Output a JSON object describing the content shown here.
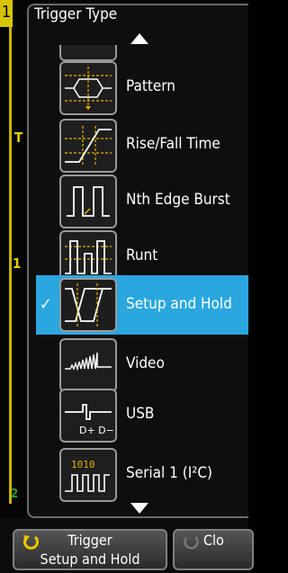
{
  "channel_marker": "1",
  "menu": {
    "title": "Trigger Type",
    "items": [
      {
        "label": "Pattern",
        "icon": "pattern-trigger-icon",
        "selected": false
      },
      {
        "label": "Rise/Fall Time",
        "icon": "rise-fall-time-icon",
        "selected": false
      },
      {
        "label": "Nth Edge Burst",
        "icon": "nth-edge-burst-icon",
        "selected": false
      },
      {
        "label": "Runt",
        "icon": "runt-icon",
        "selected": false
      },
      {
        "label": "Setup and Hold",
        "icon": "setup-and-hold-icon",
        "selected": true
      },
      {
        "label": "Video",
        "icon": "video-icon",
        "selected": false
      },
      {
        "label": "USB",
        "icon": "usb-icon",
        "selected": false
      },
      {
        "label": "Serial 1 (I²C)",
        "icon": "serial-i2c-icon",
        "selected": false
      }
    ]
  },
  "scope_labels": {
    "trigger_marker": "T",
    "ch1_ground": "1",
    "ch2_ground": "2"
  },
  "softkeys": [
    {
      "line1": "Trigger",
      "line2": "Setup and Hold"
    },
    {
      "line1": "Clo",
      "line2": ""
    }
  ],
  "colors": {
    "selected": "#2aa7df",
    "channel1": "#e8d200",
    "channel2": "#1fa51f"
  }
}
